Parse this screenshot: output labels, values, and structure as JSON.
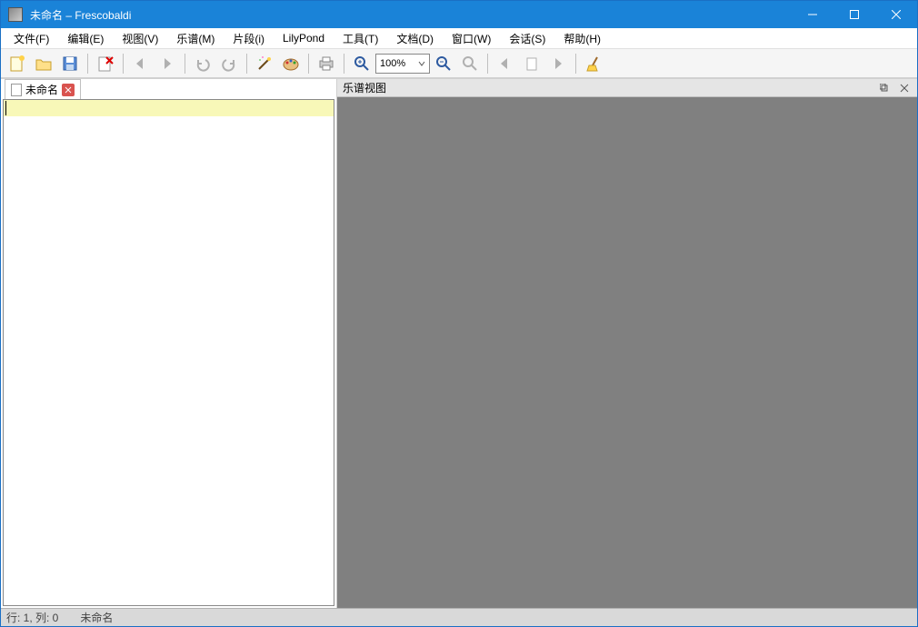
{
  "window": {
    "title": "未命名 – Frescobaldi"
  },
  "menubar": {
    "items": [
      "文件(F)",
      "编辑(E)",
      "视图(V)",
      "乐谱(M)",
      "片段(i)",
      "LilyPond",
      "工具(T)",
      "文档(D)",
      "窗口(W)",
      "会话(S)",
      "帮助(H)"
    ]
  },
  "toolbar": {
    "zoom_value": "100%"
  },
  "editor_tab": {
    "label": "未命名"
  },
  "right_pane": {
    "title": "乐谱视图"
  },
  "statusbar": {
    "position": "行: 1, 列: 0",
    "docname": "未命名"
  }
}
